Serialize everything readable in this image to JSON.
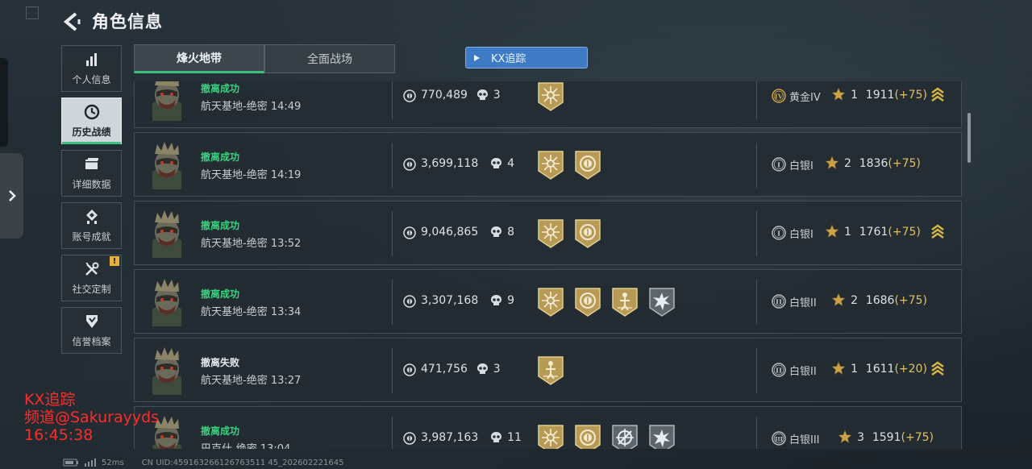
{
  "header": {
    "title": "角色信息",
    "back_icon": "back-arrow-icon"
  },
  "sidenav": {
    "items": [
      {
        "label": "个人信息",
        "icon": "bar-chart-icon",
        "active": false
      },
      {
        "label": "历史战绩",
        "icon": "clock-icon",
        "active": true
      },
      {
        "label": "详细数据",
        "icon": "folder-icon",
        "active": false
      },
      {
        "label": "账号成就",
        "icon": "medal-icon",
        "active": false
      },
      {
        "label": "社交定制",
        "icon": "tools-icon",
        "active": false,
        "alert": "!"
      },
      {
        "label": "信誉档案",
        "icon": "shield-icon",
        "active": false
      }
    ]
  },
  "tabs": [
    {
      "label": "烽火地带",
      "active": true
    },
    {
      "label": "全面战场",
      "active": false
    }
  ],
  "track_button": {
    "label": "KX追踪"
  },
  "records": [
    {
      "status": "撤离成功",
      "result": "success",
      "map": "航天基地-绝密",
      "time": "14:49",
      "money": "770,489",
      "kills": "3",
      "badges": [
        "sun"
      ],
      "rank": "黄金IV",
      "rank_numeral": "IV",
      "rank_color": "#c9a24a",
      "stars": "1",
      "score": "1911",
      "delta": "(+75)",
      "chevron": true
    },
    {
      "status": "撤离成功",
      "result": "success",
      "map": "航天基地-绝密",
      "time": "14:19",
      "money": "3,699,118",
      "kills": "4",
      "badges": [
        "sun",
        "coin"
      ],
      "rank": "白银I",
      "rank_numeral": "I",
      "rank_color": "#b9c0c4",
      "stars": "2",
      "score": "1836",
      "delta": "(+75)",
      "chevron": false
    },
    {
      "status": "撤离成功",
      "result": "success",
      "map": "航天基地-绝密",
      "time": "13:52",
      "money": "9,046,865",
      "kills": "8",
      "badges": [
        "sun",
        "coin"
      ],
      "rank": "白银I",
      "rank_numeral": "I",
      "rank_color": "#b9c0c4",
      "stars": "1",
      "score": "1761",
      "delta": "(+75)",
      "chevron": true
    },
    {
      "status": "撤离成功",
      "result": "success",
      "map": "航天基地-绝密",
      "time": "13:34",
      "money": "3,307,168",
      "kills": "9",
      "badges": [
        "sun",
        "coin",
        "figure",
        "burst"
      ],
      "rank": "白银II",
      "rank_numeral": "II",
      "rank_color": "#b9c0c4",
      "stars": "2",
      "score": "1686",
      "delta": "(+75)",
      "chevron": false
    },
    {
      "status": "撤离失败",
      "result": "fail",
      "map": "航天基地-绝密",
      "time": "13:27",
      "money": "471,756",
      "kills": "3",
      "badges": [
        "figure"
      ],
      "rank": "白银II",
      "rank_numeral": "II",
      "rank_color": "#b9c0c4",
      "stars": "1",
      "score": "1611",
      "delta": "(+20)",
      "chevron": true
    },
    {
      "status": "撤离成功",
      "result": "success",
      "map": "巴克什-绝密",
      "time": "13:04",
      "money": "3,987,163",
      "kills": "11",
      "badges": [
        "sun",
        "coin",
        "crosshair",
        "burst"
      ],
      "rank": "白银III",
      "rank_numeral": "III",
      "rank_color": "#b9c0c4",
      "stars": "3",
      "score": "1591",
      "delta": "(+75)",
      "chevron": false
    }
  ],
  "watermark": {
    "line1": "KX追踪",
    "line2": "频道@Sakurayyds",
    "line3": "16:45:38"
  },
  "footer": {
    "ping": "52ms",
    "uid": "CN UID:459163266126763511 45_202602221645"
  }
}
